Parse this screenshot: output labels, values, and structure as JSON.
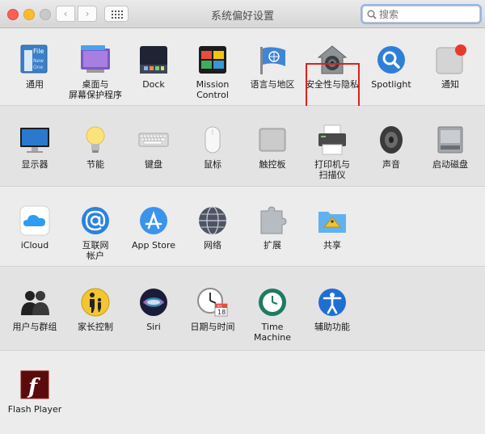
{
  "window": {
    "title": "系统偏好设置"
  },
  "toolbar": {
    "back": "‹",
    "forward": "›"
  },
  "search": {
    "placeholder": "搜索",
    "value": ""
  },
  "sections": {
    "personal": [
      {
        "label": "通用"
      },
      {
        "label": "桌面与\n屏幕保护程序"
      },
      {
        "label": "Dock"
      },
      {
        "label": "Mission\nControl"
      },
      {
        "label": "语言与地区"
      },
      {
        "label": "安全性与隐私"
      },
      {
        "label": "Spotlight"
      },
      {
        "label": "通知"
      }
    ],
    "hardware": [
      {
        "label": "显示器"
      },
      {
        "label": "节能"
      },
      {
        "label": "键盘"
      },
      {
        "label": "鼠标"
      },
      {
        "label": "触控板"
      },
      {
        "label": "打印机与\n扫描仪"
      },
      {
        "label": "声音"
      },
      {
        "label": "启动磁盘"
      }
    ],
    "internet": [
      {
        "label": "iCloud"
      },
      {
        "label": "互联网\n帐户"
      },
      {
        "label": "App Store"
      },
      {
        "label": "网络"
      },
      {
        "label": "扩展"
      },
      {
        "label": "共享"
      }
    ],
    "system": [
      {
        "label": "用户与群组"
      },
      {
        "label": "家长控制"
      },
      {
        "label": "Siri"
      },
      {
        "label": "日期与时间"
      },
      {
        "label": "Time Machine"
      },
      {
        "label": "辅助功能"
      }
    ],
    "other": [
      {
        "label": "Flash Player"
      }
    ]
  },
  "icon_text": {
    "general_file": "File",
    "general_new": "New",
    "general_one": "One",
    "calendar_month": "JUL",
    "calendar_day": "18",
    "flash_glyph": "f"
  },
  "colors": {
    "highlight": "#e0201a",
    "accent_blue": "#2f7fd8",
    "focus_ring": "#8fb5ea"
  }
}
